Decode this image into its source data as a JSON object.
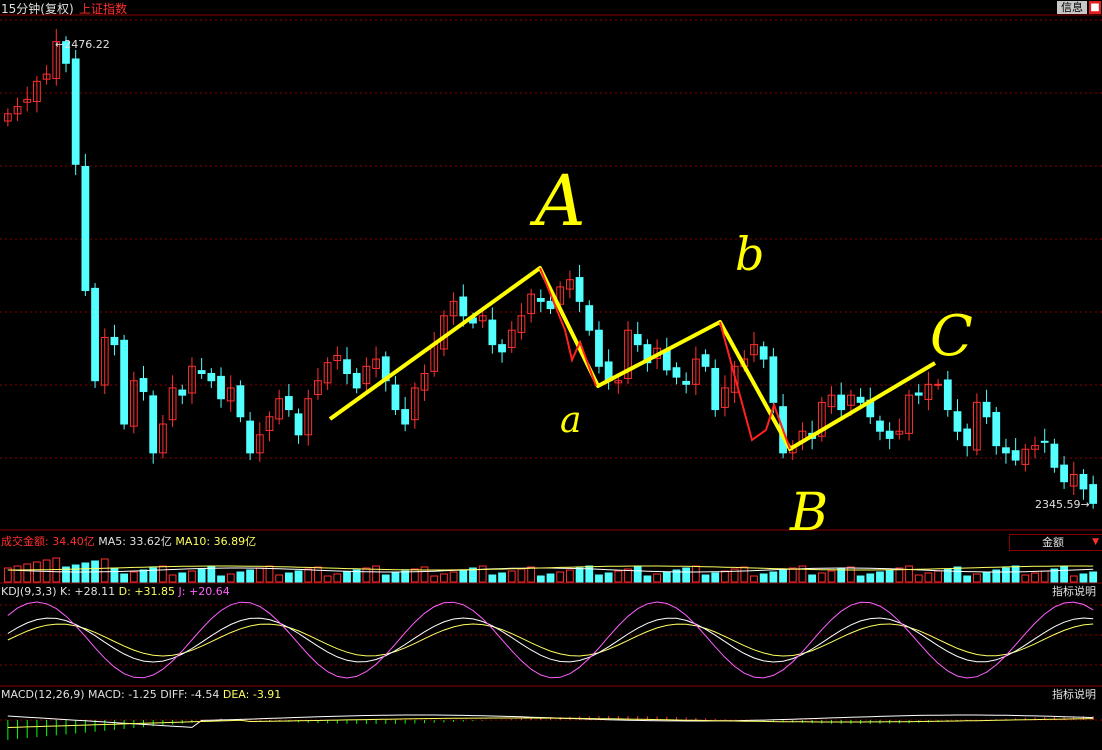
{
  "header": {
    "period_title": "15分钟(复权)",
    "index_name": "上证指数",
    "info_button": "信息",
    "close_button": "■"
  },
  "colors": {
    "up": "#ff3030",
    "down": "#54ffff",
    "grid": "#8b0000",
    "annotation_yellow": "#ffff00",
    "annotation_red": "#ff2020"
  },
  "chart_data": [
    {
      "type": "candlestick",
      "title": "15分钟(复权) 上证指数",
      "high_label": "2476.22",
      "low_label": "2345.59",
      "ylim": [
        2340,
        2480
      ],
      "grid": true,
      "closes": [
        2454,
        2456,
        2458,
        2463,
        2465,
        2474,
        2468,
        2440,
        2405,
        2380,
        2392,
        2390,
        2368,
        2380,
        2377,
        2360,
        2368,
        2378,
        2376,
        2384,
        2382,
        2380,
        2375,
        2378,
        2370,
        2360,
        2365,
        2370,
        2375,
        2372,
        2365,
        2375,
        2380,
        2385,
        2387,
        2382,
        2378,
        2384,
        2386,
        2380,
        2372,
        2368,
        2378,
        2382,
        2390,
        2398,
        2402,
        2398,
        2396,
        2398,
        2390,
        2388,
        2394,
        2398,
        2404,
        2402,
        2400,
        2406,
        2408,
        2402,
        2394,
        2384,
        2380,
        2380,
        2394,
        2390,
        2385,
        2389,
        2383,
        2381,
        2379,
        2386,
        2384,
        2372,
        2378,
        2384,
        2386,
        2390,
        2386,
        2374,
        2360,
        2362,
        2366,
        2364,
        2374,
        2376,
        2372,
        2376,
        2374,
        2370,
        2366,
        2364,
        2366,
        2376,
        2376,
        2379,
        2379,
        2372,
        2366,
        2362,
        2374,
        2370,
        2362,
        2360,
        2358,
        2361,
        2362,
        2363,
        2356,
        2352,
        2354,
        2350,
        2346
      ]
    },
    {
      "type": "bar",
      "title": "成交金额",
      "series": [
        {
          "name": "成交金额",
          "current": "34.40亿"
        },
        {
          "name": "MA5",
          "current": "33.62亿"
        },
        {
          "name": "MA10",
          "current": "36.89亿"
        }
      ],
      "selector": "金额"
    },
    {
      "type": "line",
      "title": "KDJ(9,3,3)",
      "series": [
        {
          "name": "K",
          "current": "+28.11"
        },
        {
          "name": "D",
          "current": "+31.85"
        },
        {
          "name": "J",
          "current": "+20.64"
        }
      ],
      "help": "指标说明"
    },
    {
      "type": "line",
      "title": "MACD(12,26,9)",
      "series": [
        {
          "name": "MACD",
          "current": "-1.25"
        },
        {
          "name": "DIFF",
          "current": "-4.54"
        },
        {
          "name": "DEA",
          "current": "-3.91"
        }
      ],
      "help": "指标说明"
    }
  ],
  "annotations": {
    "wave_labels": [
      "A",
      "b",
      "C",
      "a",
      "B"
    ]
  },
  "panels": {
    "volume": {
      "title": "成交金额: ",
      "value": "34.40亿",
      "ma5_label": "MA5: ",
      "ma5": "33.62亿",
      "ma10_label": "MA10: ",
      "ma10": "36.89亿",
      "select": "金额"
    },
    "kdj": {
      "title": "KDJ(9,3,3) ",
      "k_label": "K: ",
      "k": "+28.11",
      "d_label": " D: ",
      "d": "+31.85",
      "j_label": " J: ",
      "j": "+20.64",
      "help": "指标说明"
    },
    "macd": {
      "title": "MACD(12,26,9) ",
      "macd_label": "MACD: ",
      "macd": "-1.25",
      "diff_label": " DIFF: ",
      "diff": "-4.54",
      "dea_label": " DEA: ",
      "dea": "-3.91",
      "help": "指标说明"
    }
  }
}
